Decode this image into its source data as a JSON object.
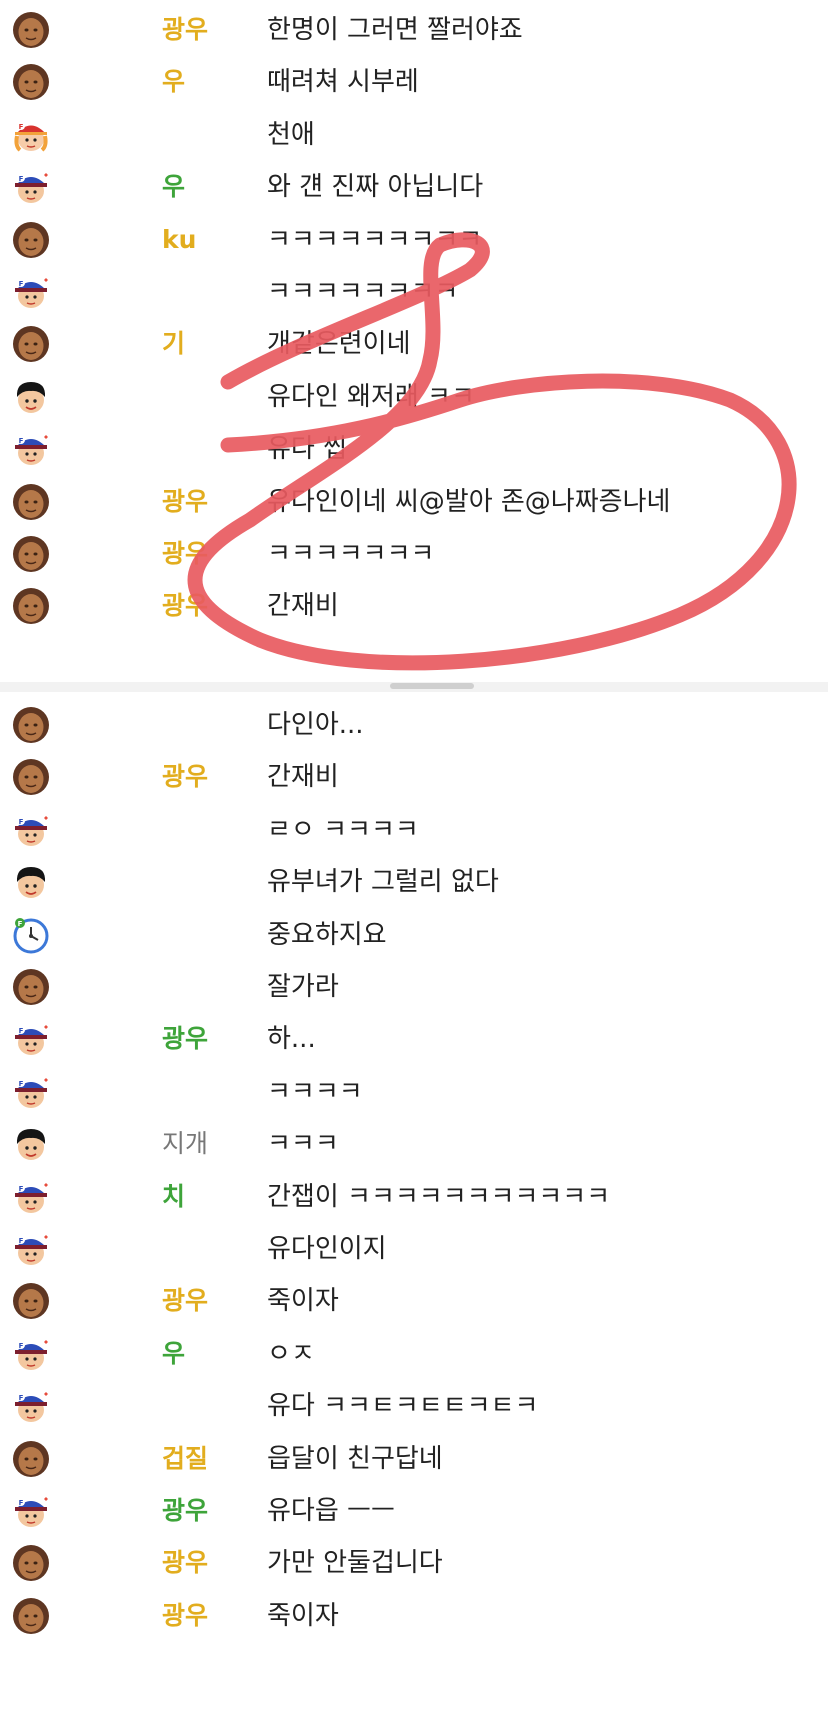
{
  "screenshots": [
    {
      "messages": [
        {
          "avatar": "brown-face-avatar",
          "name": "광우",
          "name_color": "gold",
          "text": "한명이 그러면 짤러야죠"
        },
        {
          "avatar": "brown-face-avatar",
          "name": "우",
          "name_color": "gold",
          "text": "때려쳐 시부레"
        },
        {
          "avatar": "girl-cap-avatar",
          "name": "",
          "name_color": "gold",
          "text": "천애"
        },
        {
          "avatar": "blue-cap-avatar",
          "name": "우",
          "name_color": "green",
          "text": "와 걘 진짜 아닙니다"
        },
        {
          "avatar": "brown-face-avatar",
          "name": "ku",
          "name_color": "gold",
          "text": "ㅋㅋㅋㅋㅋㅋㅋㅋㅋ"
        },
        {
          "avatar": "blue-cap-avatar",
          "name": "",
          "name_color": "green",
          "text": "ㅋㅋㅋㅋㅋㅋㅋㅋ"
        },
        {
          "avatar": "brown-face-avatar",
          "name": "기",
          "name_color": "gold",
          "text": "개같은련이네"
        },
        {
          "avatar": "black-hair-avatar",
          "name": "",
          "name_color": "gray",
          "text": "유다인 왜저래 ㅋㅋ"
        },
        {
          "avatar": "blue-cap-avatar",
          "name": "",
          "name_color": "green",
          "text": "유다 씹"
        },
        {
          "avatar": "brown-face-avatar",
          "name": "광우",
          "name_color": "gold",
          "text": "유다인이네 씨@발아 존@나짜증나네"
        },
        {
          "avatar": "brown-face-avatar",
          "name": "광우",
          "name_color": "gold",
          "text": "ㅋㅋㅋㅋㅋㅋㅋ"
        },
        {
          "avatar": "brown-face-avatar",
          "name": "광우",
          "name_color": "gold",
          "text": "간재비"
        }
      ]
    },
    {
      "messages": [
        {
          "avatar": "brown-face-avatar",
          "name": "",
          "name_color": "gold",
          "text": "다인아..."
        },
        {
          "avatar": "brown-face-avatar",
          "name": "광우",
          "name_color": "gold",
          "text": "간재비"
        },
        {
          "avatar": "blue-cap-avatar",
          "name": "",
          "name_color": "green",
          "text": "ㄹㅇ ㅋㅋㅋㅋ"
        },
        {
          "avatar": "black-hair-avatar",
          "name": "",
          "name_color": "gray",
          "text": "유부녀가 그럴리 없다"
        },
        {
          "avatar": "clock-avatar",
          "name": "",
          "name_color": "gray",
          "text": "중요하지요"
        },
        {
          "avatar": "brown-face-avatar",
          "name": "",
          "name_color": "gold",
          "text": "잘가라"
        },
        {
          "avatar": "blue-cap-avatar",
          "name": "광우",
          "name_color": "green",
          "text": "하..."
        },
        {
          "avatar": "blue-cap-avatar",
          "name": "",
          "name_color": "green",
          "text": "ㅋㅋㅋㅋ"
        },
        {
          "avatar": "black-hair-avatar",
          "name": "지개",
          "name_color": "gray",
          "text": "ㅋㅋㅋ"
        },
        {
          "avatar": "blue-cap-avatar",
          "name": "치",
          "name_color": "green",
          "text": "간잽이 ㅋㅋㅋㅋㅋㅋㅋㅋㅋㅋㅋ"
        },
        {
          "avatar": "blue-cap-avatar",
          "name": "",
          "name_color": "green",
          "text": "유다인이지"
        },
        {
          "avatar": "brown-face-avatar",
          "name": "광우",
          "name_color": "gold",
          "text": "죽이자"
        },
        {
          "avatar": "blue-cap-avatar",
          "name": "우",
          "name_color": "green",
          "text": "ㅇㅈ"
        },
        {
          "avatar": "blue-cap-avatar",
          "name": "",
          "name_color": "green",
          "text": "유다 ㅋㅋㅌㅋㅌㅌㅋㅌㅋ"
        },
        {
          "avatar": "brown-face-avatar",
          "name": "겁질",
          "name_color": "gold",
          "text": "읍달이 친구답네"
        },
        {
          "avatar": "blue-cap-avatar",
          "name": "광우",
          "name_color": "green",
          "text": "유다읍 ㅡㅡ"
        },
        {
          "avatar": "brown-face-avatar",
          "name": "광우",
          "name_color": "gold",
          "text": "가만 안둘겁니다"
        },
        {
          "avatar": "brown-face-avatar",
          "name": "광우",
          "name_color": "gold",
          "text": "죽이자"
        }
      ]
    }
  ],
  "colors": {
    "gold": "#e2ad1e",
    "green": "#3ea43a",
    "gray": "#777777",
    "message_text": "#222222",
    "scribble": "#e85a60"
  }
}
